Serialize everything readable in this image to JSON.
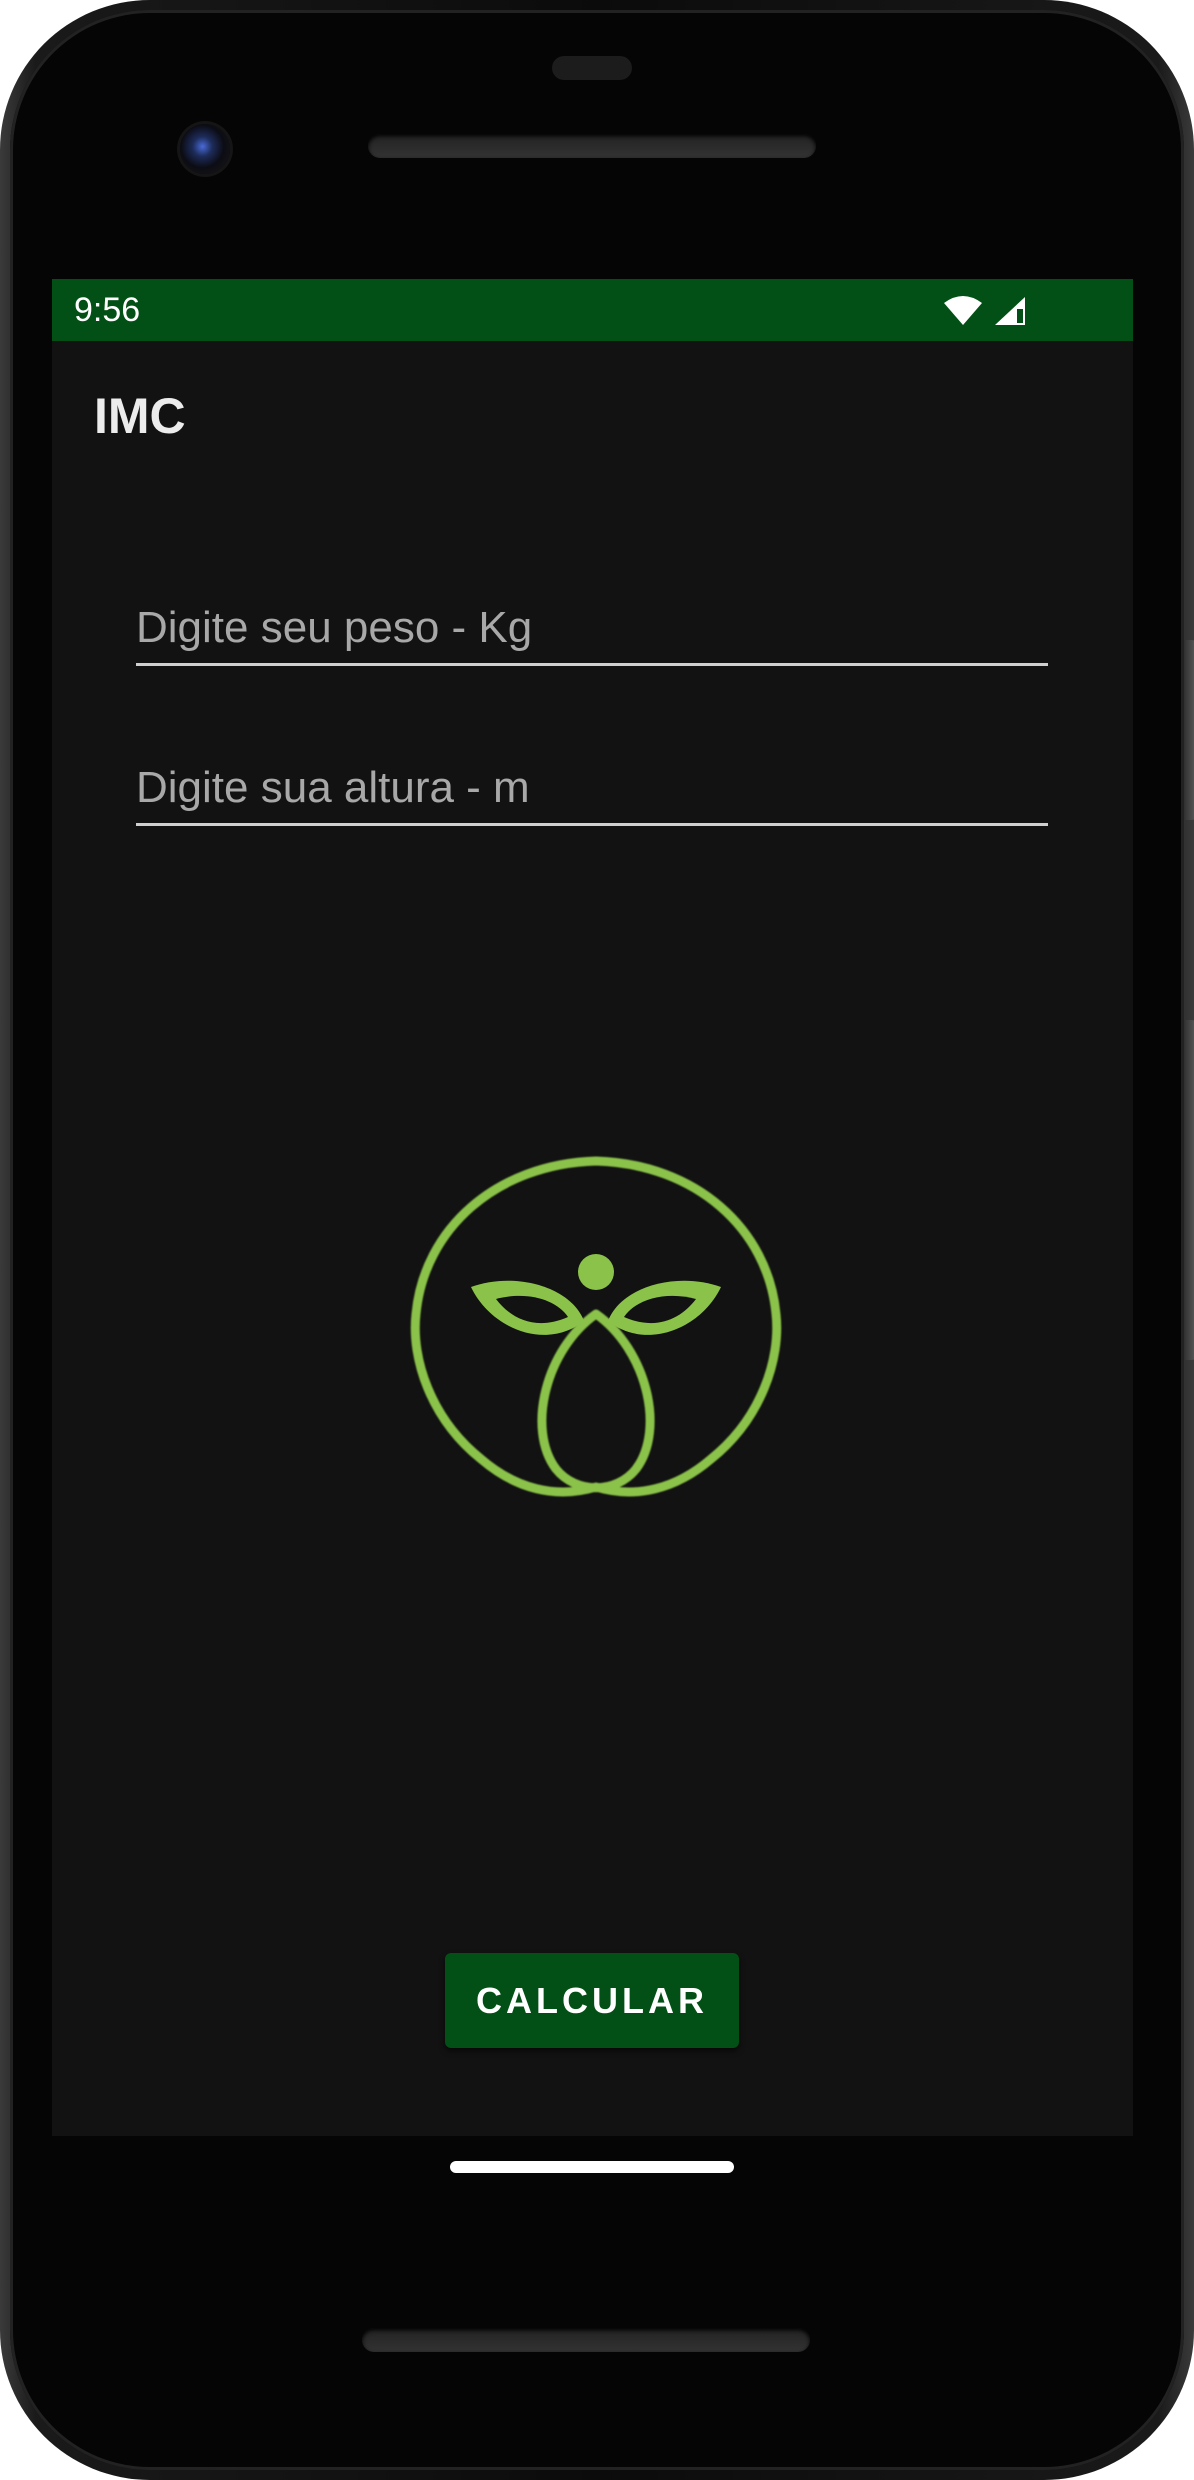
{
  "status_bar": {
    "time": "9:56",
    "background_color": "#025015",
    "icons": [
      "wifi-icon",
      "cell-signal-icon"
    ]
  },
  "app": {
    "title": "IMC",
    "background_color": "#121212"
  },
  "form": {
    "weight_placeholder": "Digite seu peso - Kg",
    "height_placeholder": "Digite sua altura - m",
    "weight_value": "",
    "height_value": ""
  },
  "logo": {
    "icon": "butterfly-figure-logo",
    "color": "#8bc34a"
  },
  "button": {
    "label": "CALCULAR",
    "color": "#025015"
  }
}
